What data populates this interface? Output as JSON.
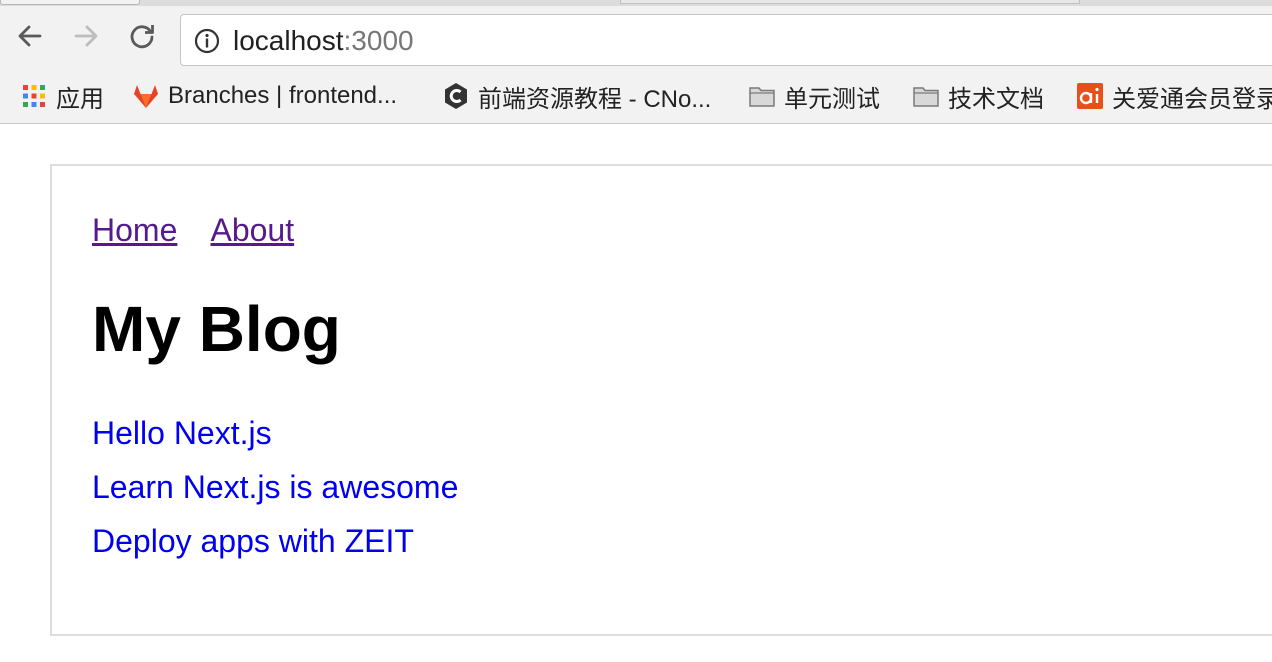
{
  "browser": {
    "url_host": "localhost",
    "url_port": ":3000",
    "bookmarks": [
      {
        "label": "应用",
        "icon": "apps-grid-icon"
      },
      {
        "label": "Branches | frontend...",
        "icon": "gitlab-fox-icon"
      },
      {
        "label": "前端资源教程 - CNo...",
        "icon": "cnodejs-hexagon-icon"
      },
      {
        "label": "单元测试",
        "icon": "folder-icon"
      },
      {
        "label": "技术文档",
        "icon": "folder-icon"
      },
      {
        "label": "关爱通会员登录",
        "icon": "ai-brand-icon"
      }
    ]
  },
  "page": {
    "nav": [
      {
        "label": "Home"
      },
      {
        "label": "About"
      }
    ],
    "title": "My Blog",
    "posts": [
      {
        "title": "Hello Next.js"
      },
      {
        "title": "Learn Next.js is awesome"
      },
      {
        "title": "Deploy apps with ZEIT"
      }
    ]
  },
  "colors": {
    "visited_link": "#551a8b",
    "link": "#0000ee",
    "gitlab_orange": "#e24329",
    "brand_orange": "#e8501a"
  }
}
